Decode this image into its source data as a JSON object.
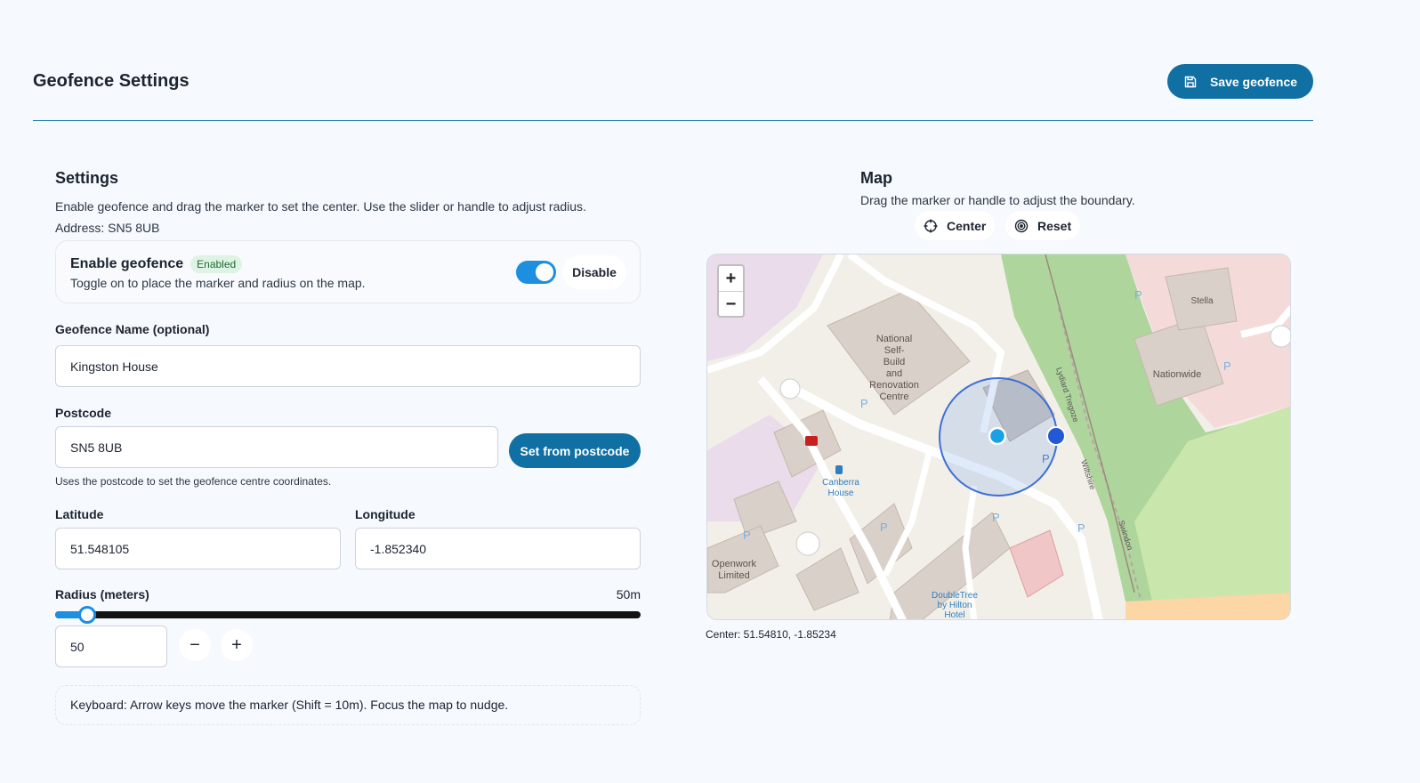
{
  "header": {
    "title": "Geofence Settings",
    "save_label": "Save geofence"
  },
  "settings": {
    "title": "Settings",
    "description": "Enable geofence and drag the marker to set the center. Use the slider or handle to adjust radius.",
    "address": "Address: SN5 8UB",
    "toggle": {
      "title": "Enable geofence",
      "badge": "Enabled",
      "subtitle": "Toggle on to place the marker and radius on the map.",
      "enabled": true,
      "button_label": "Disable"
    },
    "name_field": {
      "label": "Geofence Name (optional)",
      "value": "Kingston House"
    },
    "postcode_field": {
      "label": "Postcode",
      "value": "SN5 8UB",
      "button_label": "Set from postcode",
      "helper": "Uses the postcode to set the geofence centre coordinates."
    },
    "latitude": {
      "label": "Latitude",
      "value": "51.548105"
    },
    "longitude": {
      "label": "Longitude",
      "value": "-1.852340"
    },
    "radius": {
      "label": "Radius (meters)",
      "display": "50m",
      "value": "50",
      "fraction": 0.055
    },
    "keyboard_note": "Keyboard: Arrow keys move the marker (Shift = 10m). Focus the map to nudge."
  },
  "map": {
    "title": "Map",
    "description": "Drag the marker or handle to adjust the boundary.",
    "center_label": "Center",
    "reset_label": "Reset",
    "zoom_in": "+",
    "zoom_out": "−",
    "center_readout": "Center: 51.54810, -1.85234",
    "labels": {
      "building1": "National",
      "building2": "Self-",
      "building3": "Build",
      "building4": "and",
      "building5": "Renovation",
      "building6": "Centre",
      "stella": "Stella",
      "nationwide": "Nationwide",
      "canberra1": "Canberra",
      "canberra2": "House",
      "openwork1": "Openwork",
      "openwork2": "Limited",
      "doubletree1": "DoubleTree",
      "doubletree2": "by Hilton",
      "doubletree3": "Hotel",
      "lydiard": "Lydiard Tregoze",
      "wiltshire": "Wiltshire",
      "swindon": "Swindon",
      "parking": "P"
    }
  },
  "colors": {
    "accent": "#106fa3",
    "toggle": "#1d8fe0",
    "badge_bg": "#dff3e5"
  }
}
